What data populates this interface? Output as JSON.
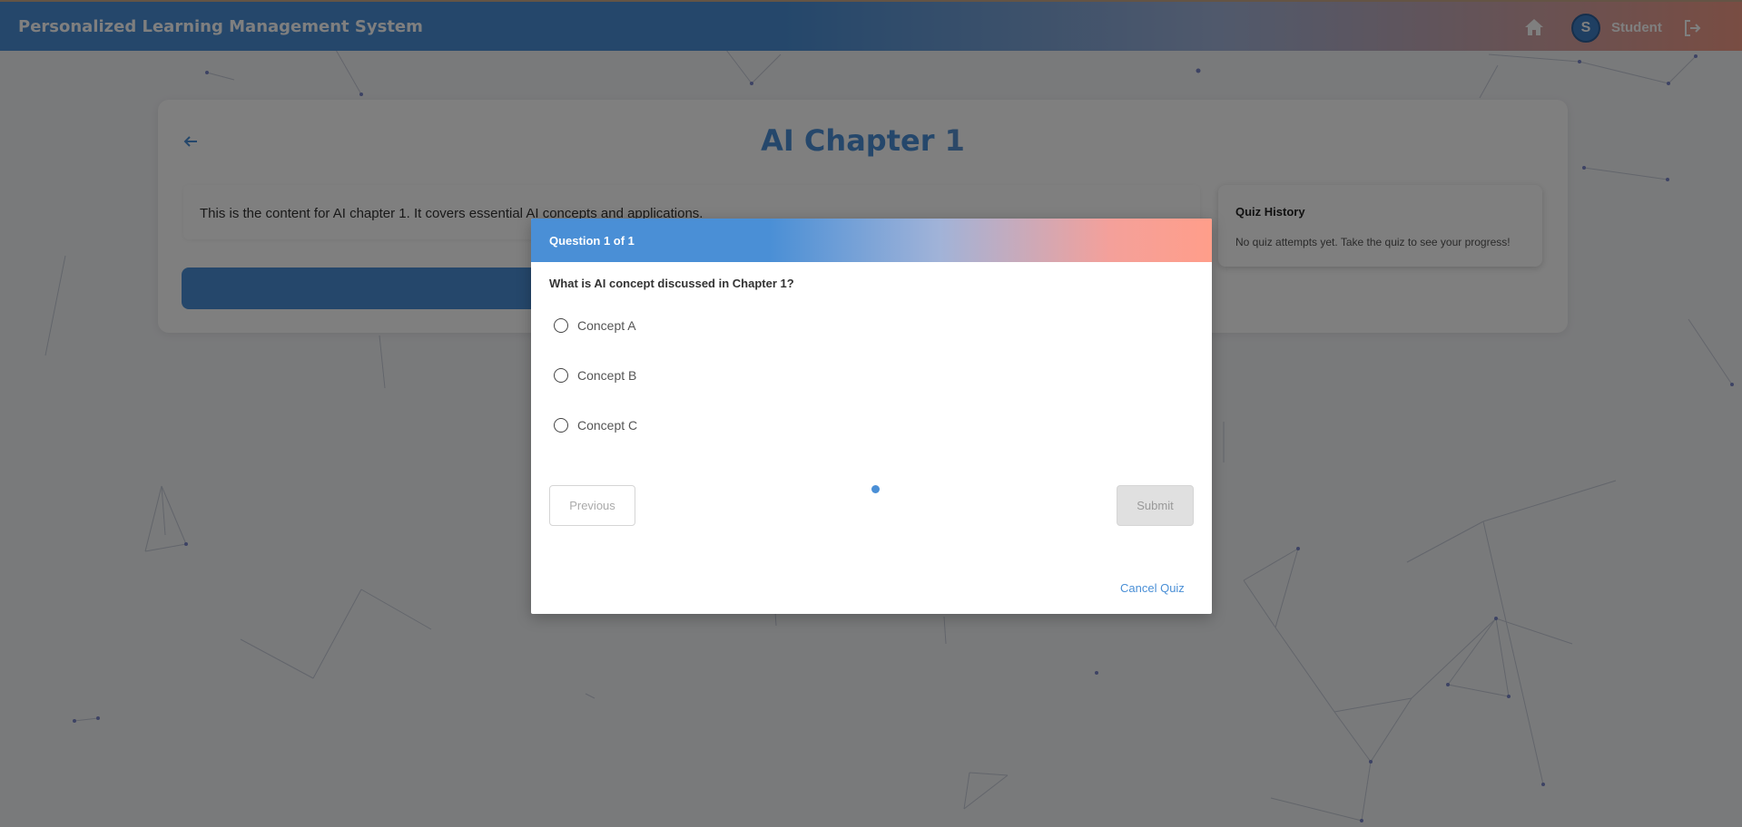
{
  "header": {
    "app_title": "Personalized Learning Management System",
    "avatar_initial": "S",
    "user_name": "Student"
  },
  "chapter": {
    "title": "AI Chapter 1",
    "content": "This is the content for AI chapter 1. It covers essential AI concepts and applications."
  },
  "quiz_history": {
    "title": "Quiz History",
    "empty_text": "No quiz attempts yet. Take the quiz to see your progress!"
  },
  "quiz_modal": {
    "header": "Question 1 of 1",
    "question": "What is AI concept discussed in Chapter 1?",
    "options": [
      "Concept A",
      "Concept B",
      "Concept C"
    ],
    "previous_label": "Previous",
    "submit_label": "Submit",
    "cancel_label": "Cancel Quiz"
  },
  "colors": {
    "primary": "#4a8fd6",
    "accent": "#f29a86"
  }
}
